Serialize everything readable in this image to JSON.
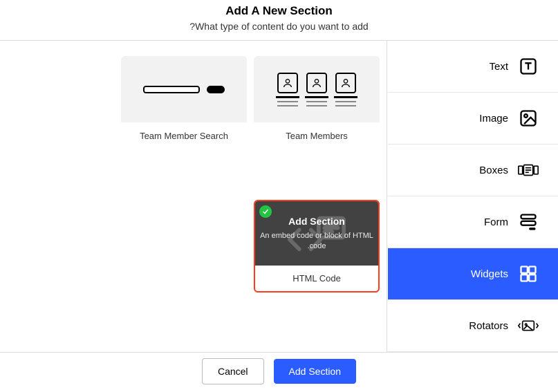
{
  "header": {
    "title": "Add A New Section",
    "subtitle": "What type of content do you want to add?"
  },
  "sidebar": {
    "items": [
      {
        "label": "Text"
      },
      {
        "label": "Image"
      },
      {
        "label": "Boxes"
      },
      {
        "label": "Form"
      },
      {
        "label": "Widgets"
      },
      {
        "label": "Rotators"
      }
    ],
    "active_index": 4
  },
  "cards": [
    {
      "label": "Team Members"
    },
    {
      "label": "Team Member Search"
    },
    {
      "label": "HTML Code"
    }
  ],
  "selected_card": {
    "title": "Add Section",
    "description": "An embed code or block of HTML code."
  },
  "footer": {
    "primary": "Add Section",
    "secondary": "Cancel"
  }
}
